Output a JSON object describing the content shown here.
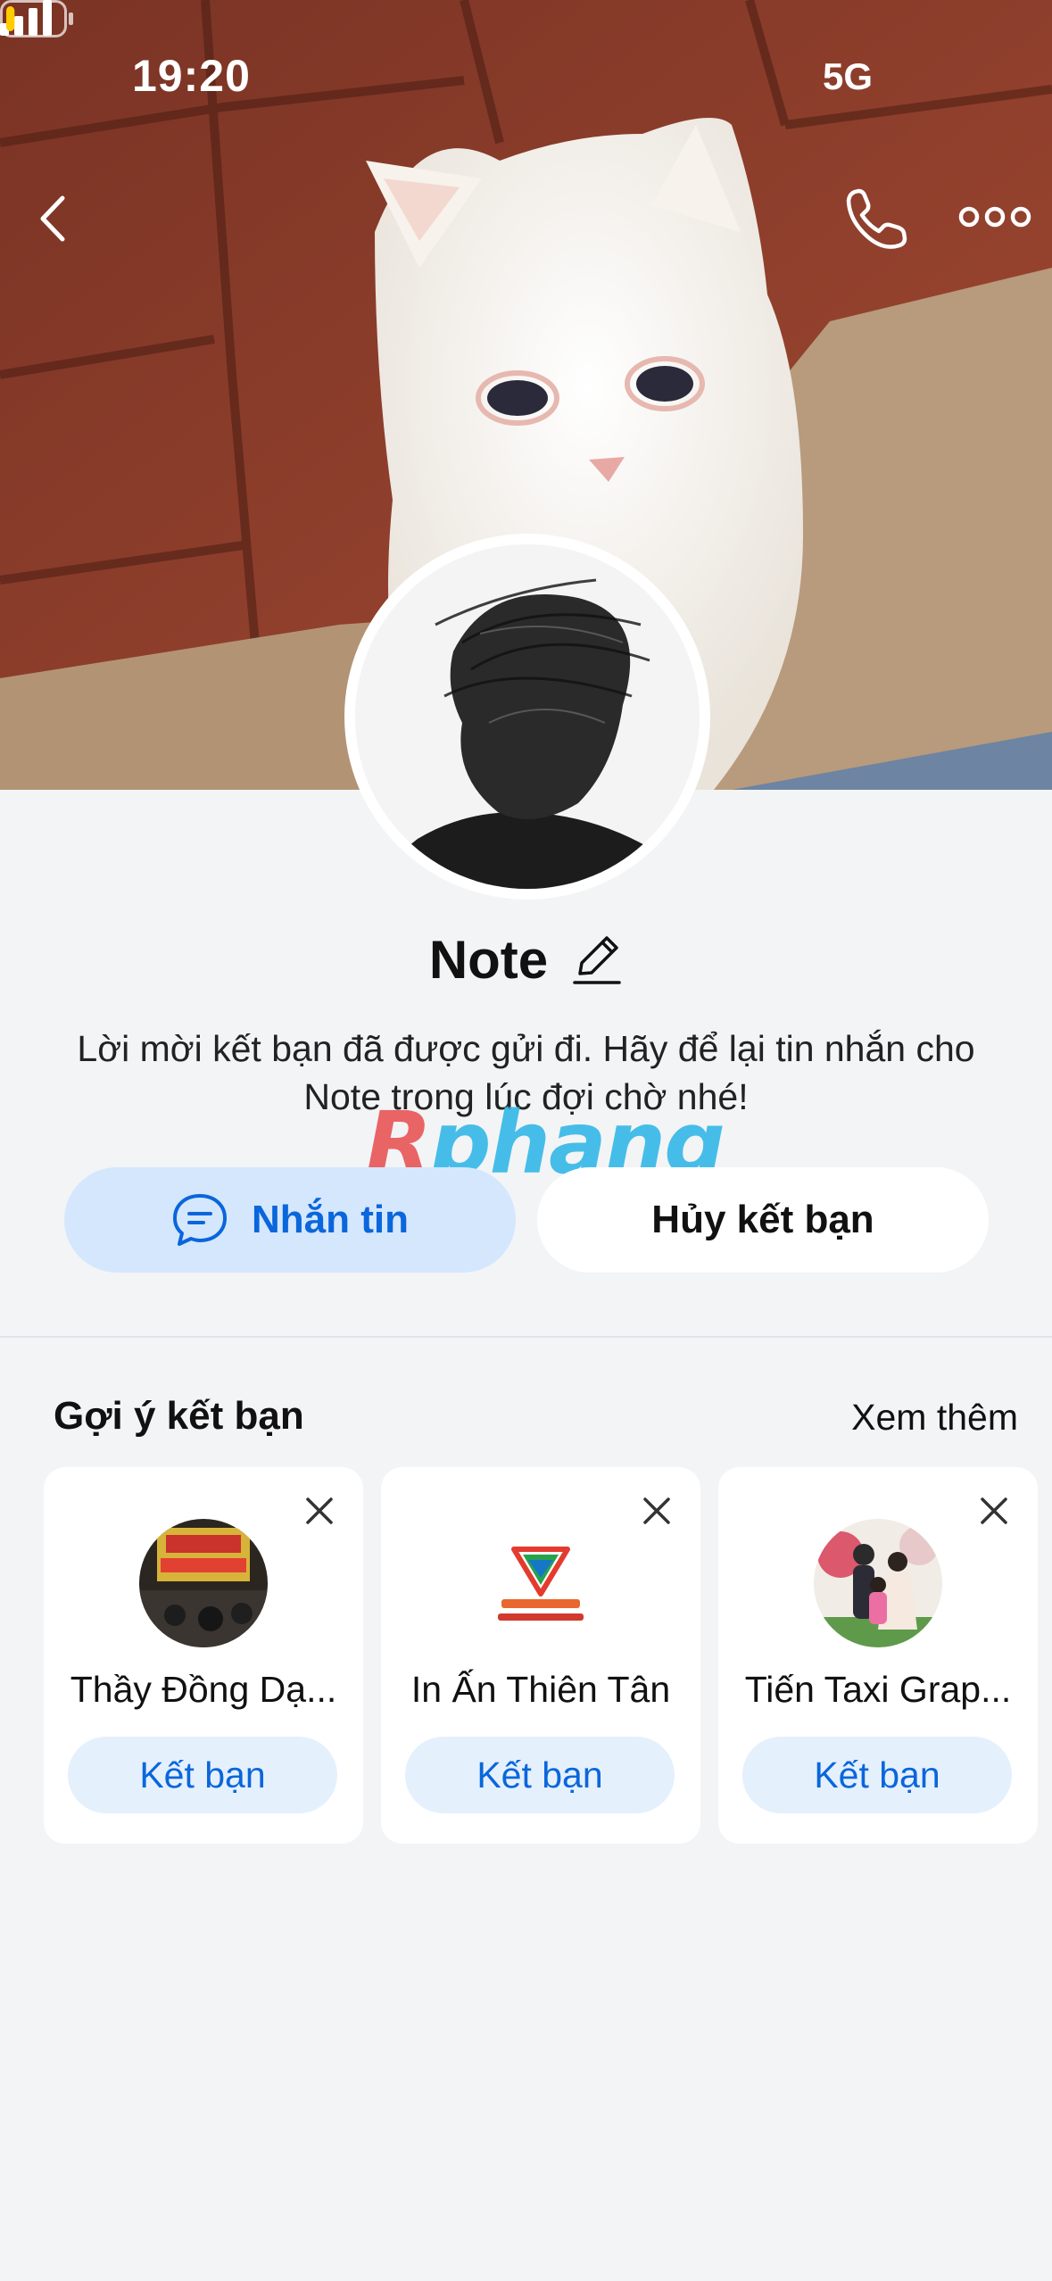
{
  "status_bar": {
    "time": "19:20",
    "network": "5G",
    "battery_level": 0.15
  },
  "header": {
    "back_icon": "chevron-left-icon",
    "call_icon": "phone-icon",
    "more_icon": "more-horizontal-icon"
  },
  "profile": {
    "name": "Note",
    "edit_icon": "pencil-icon",
    "message": "Lời mời kết bạn đã được gửi đi. Hãy để lại tin nhắn cho Note trong lúc đợi chờ nhé!",
    "watermark": "Rphang"
  },
  "actions": {
    "message_label": "Nhắn tin",
    "message_icon": "chat-bubble-icon",
    "unfriend_label": "Hủy kết bạn"
  },
  "suggestions": {
    "title": "Gợi ý kết bạn",
    "see_more": "Xem thêm",
    "items": [
      {
        "name": "Thầy Đồng Dạ...",
        "button": "Kết bạn"
      },
      {
        "name": "In Ấn Thiên Tân",
        "button": "Kết bạn"
      },
      {
        "name": "Tiến Taxi Grap...",
        "button": "Kết bạn"
      }
    ]
  },
  "colors": {
    "accent": "#0a66db",
    "accent_bg": "#d5e7fd",
    "background": "#f3f4f6"
  }
}
